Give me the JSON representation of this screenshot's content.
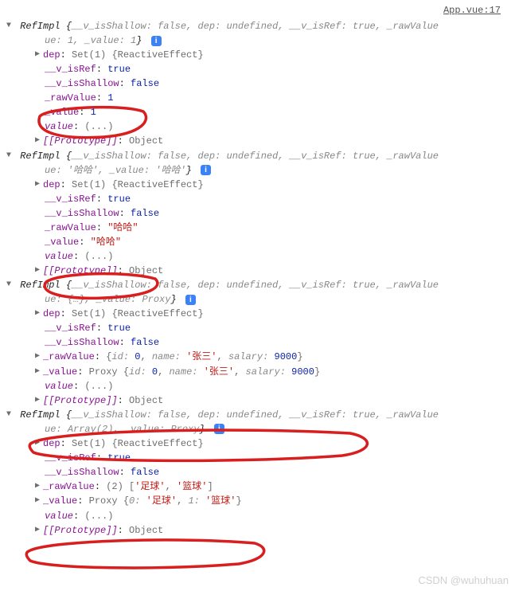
{
  "source": {
    "file": "App.vue",
    "line": "17"
  },
  "literals": {
    "RefImpl": "RefImpl",
    "brace_open": "{",
    "brace_close": "}",
    "bracket_open": "[",
    "bracket_close": "]",
    "comma": ", ",
    "colon": ": ",
    "Set1": "Set(1)",
    "ReactiveEffect": "{ReactiveEffect}",
    "true": "true",
    "false": "false",
    "undefined": "undefined",
    "ellipsis": "(...)",
    "Object": "Object",
    "Proxy": "Proxy",
    "Array2": "Array(2)",
    "paren2": "(2)",
    "i": "i",
    "objDots": "{…}"
  },
  "props": {
    "isShallow": "__v_isShallow",
    "dep": "dep",
    "isRef": "__v_isRef",
    "rawValue": "_rawValue",
    "valueU": "_value",
    "value": "value",
    "ue": "ue",
    "proto": "[[Prototype]]",
    "id": "id",
    "name": "name",
    "salary": "salary",
    "k0": "0",
    "k1": "1"
  },
  "obj1": {
    "raw": "1",
    "val": "1"
  },
  "obj2": {
    "preview": "'哈哈'",
    "raw": "\"哈哈\"",
    "val": "\"哈哈\""
  },
  "obj3": {
    "raw_id": "0",
    "raw_name": "'张三'",
    "raw_salary": "9000",
    "val_id": "0",
    "val_name": "'张三'",
    "val_salary": "9000"
  },
  "obj4": {
    "raw0": "'足球'",
    "raw1": "'篮球'",
    "val0": "'足球'",
    "val1": "'篮球'"
  },
  "watermark": "CSDN @wuhuhuan"
}
